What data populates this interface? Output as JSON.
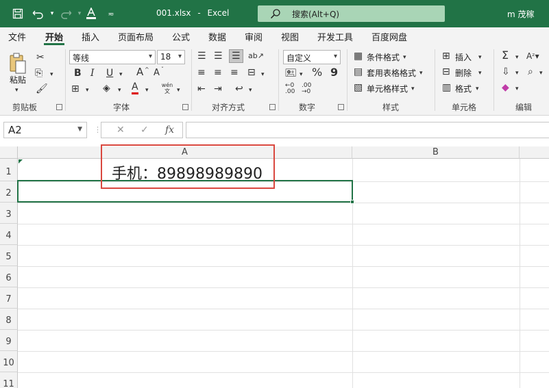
{
  "titlebar": {
    "filename": "001.xlsx",
    "separator": "-",
    "app": "Excel",
    "search_placeholder": "搜索(Alt+Q)",
    "user": "m 茂稼"
  },
  "tabs": [
    "文件",
    "开始",
    "插入",
    "页面布局",
    "公式",
    "数据",
    "审阅",
    "视图",
    "开发工具",
    "百度网盘"
  ],
  "active_tab": "开始",
  "ribbon": {
    "clipboard": {
      "paste": "粘贴",
      "label": "剪贴板"
    },
    "font": {
      "name": "等线",
      "size": "18",
      "label": "字体",
      "bold": "B",
      "italic": "I",
      "underline": "U",
      "grow": "A",
      "shrink": "A",
      "font_color": "A",
      "wen": "wén 文"
    },
    "alignment": {
      "label": "对齐方式"
    },
    "number": {
      "format": "自定义",
      "percent": "%",
      "comma": "9",
      "label": "数字"
    },
    "styles": {
      "conditional": "条件格式",
      "table": "套用表格格式",
      "cell_styles": "单元格样式",
      "label": "样式"
    },
    "cells": {
      "insert": "插入",
      "delete": "删除",
      "format": "格式",
      "label": "单元格"
    },
    "editing": {
      "label": "编辑"
    }
  },
  "formula_bar": {
    "name_box": "A2",
    "cancel": "✕",
    "enter": "✓",
    "fx": "fx",
    "content": ""
  },
  "grid": {
    "columns": [
      "A",
      "B"
    ],
    "rows": [
      "1",
      "2",
      "3",
      "4",
      "5",
      "6",
      "7",
      "8",
      "9",
      "10",
      "11"
    ],
    "cells": {
      "A1": "手机：89898989890"
    },
    "selected": "A2"
  },
  "colors": {
    "accent": "#217346",
    "annotation": "#d9473e"
  }
}
